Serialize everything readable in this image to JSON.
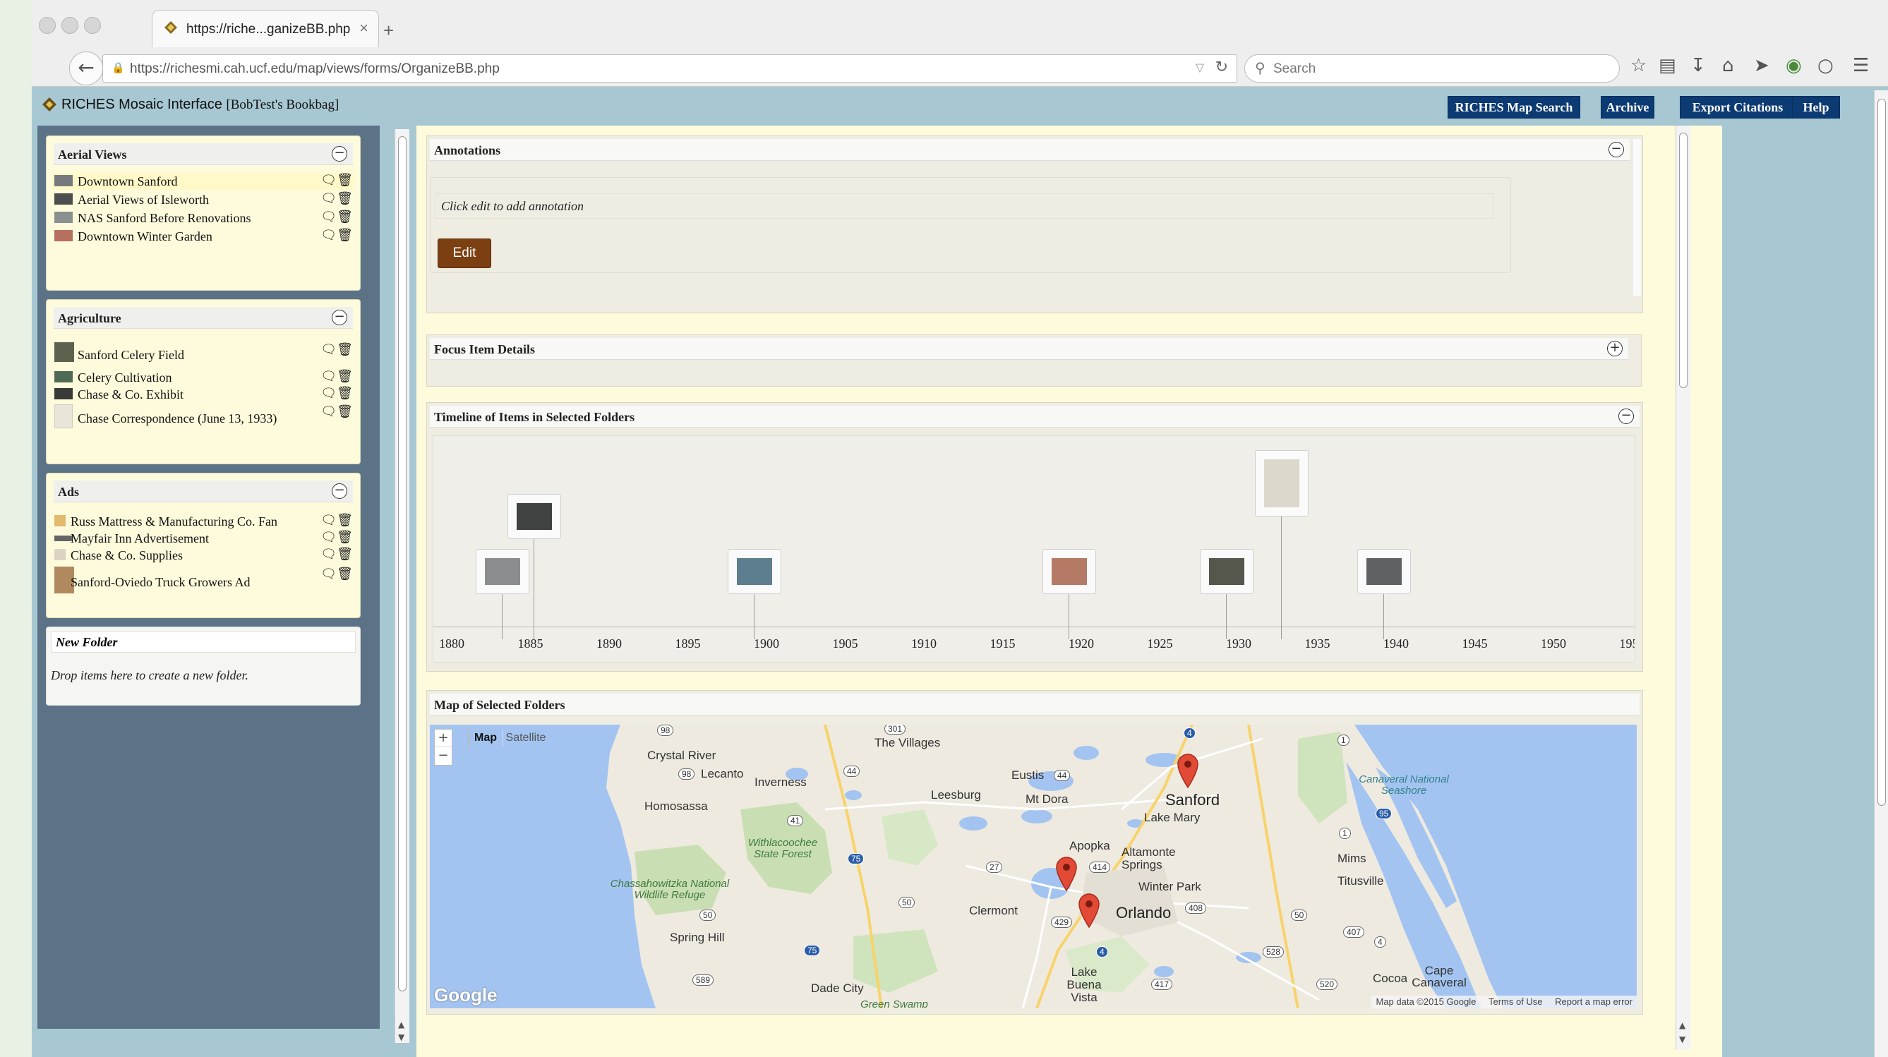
{
  "browser": {
    "tab_title": "https://riche...ganizeBB.php",
    "tab_close": "×",
    "new_tab": "+",
    "back": "←",
    "url": "https://richesmi.cah.ucf.edu/map/views/forms/OrganizeBB.php",
    "reload": "↻",
    "url_dropdown": "▽",
    "search_placeholder": "Search",
    "toolbar_icons": [
      "bookmark-star-icon",
      "reading-list-icon",
      "download-icon",
      "home-icon",
      "send-icon",
      "addon-icon",
      "chat-icon",
      "menu-icon"
    ]
  },
  "app": {
    "title": "RICHES Mosaic Interface",
    "bookbag": "[BobTest's Bookbag]",
    "nav": [
      "RICHES Map Search",
      "Archive",
      "Export Citations",
      "Help"
    ],
    "colors": {
      "nav_bg": "#0c3a73",
      "sidebar_bg": "#5b7287",
      "page_bg": "#a7c8d2",
      "folder_bg": "#fdfbdb",
      "edit_btn": "#7b3f12",
      "pin": "#e24a35"
    }
  },
  "folders": [
    {
      "name": "Aerial Views",
      "items": [
        "Downtown Sanford",
        "Aerial Views of Isleworth",
        "NAS Sanford Before Renovations",
        "Downtown Winter Garden"
      ]
    },
    {
      "name": "Agriculture",
      "items": [
        "Sanford Celery Field",
        "Celery Cultivation",
        "Chase & Co. Exhibit",
        "Chase Correspondence (June 13, 1933)"
      ]
    },
    {
      "name": "Ads",
      "items": [
        "Russ Mattress & Manufacturing Co. Fan",
        "Mayfair Inn Advertisement",
        "Chase & Co. Supplies",
        "Sanford-Oviedo Truck Growers Ad"
      ]
    }
  ],
  "new_folder": {
    "title": "New Folder",
    "hint": "Drop items here to create a new folder."
  },
  "collapse_symbol": "−",
  "expand_symbol": "+",
  "annotations": {
    "title": "Annotations",
    "placeholder": "Click edit to add annotation",
    "edit": "Edit"
  },
  "focus": {
    "title": "Focus Item Details"
  },
  "timeline": {
    "title": "Timeline of Items in Selected Folders",
    "ticks": [
      "1880",
      "1885",
      "1890",
      "1895",
      "1900",
      "1905",
      "1910",
      "1915",
      "1920",
      "1925",
      "1930",
      "1935",
      "1940",
      "1945",
      "1950",
      "195"
    ],
    "items": [
      {
        "year": 1883,
        "level": 0
      },
      {
        "year": 1885,
        "level": 1
      },
      {
        "year": 1899,
        "level": 0
      },
      {
        "year": 1919,
        "level": 0
      },
      {
        "year": 1929,
        "level": 0
      },
      {
        "year": 1932.5,
        "level": 2
      },
      {
        "year": 1939,
        "level": 0
      }
    ]
  },
  "map": {
    "title": "Map of Selected Folders",
    "zoom_in": "+",
    "zoom_out": "−",
    "type_map": "Map",
    "type_satellite": "Satellite",
    "places": [
      "The Villages",
      "Crystal River",
      "Lecanto",
      "Inverness",
      "Homosassa",
      "Leesburg",
      "Eustis",
      "Mt Dora",
      "Sanford",
      "Lake Mary",
      "Apopka",
      "Altamonte Springs",
      "Winter Park",
      "Clermont",
      "Orlando",
      "Spring Hill",
      "Dade City",
      "Lake Buena Vista",
      "Mims",
      "Titusville",
      "Cocoa",
      "Cape Canaveral"
    ],
    "parks": [
      "Withlacoochee State Forest",
      "Chassahowitzka National Wildlife Refuge",
      "Green Swamp"
    ],
    "coast": [
      "Canaveral National Seashore"
    ],
    "road_numbers": [
      "301",
      "98",
      "98",
      "44",
      "41",
      "75",
      "27",
      "44",
      "414",
      "429",
      "408",
      "50",
      "50",
      "589",
      "75",
      "4",
      "4",
      "1",
      "1",
      "95",
      "417",
      "520",
      "528",
      "50",
      "407",
      "4"
    ],
    "logo": "Google",
    "attribution": [
      "Map data ©2015 Google",
      "Terms of Use",
      "Report a map error"
    ]
  }
}
